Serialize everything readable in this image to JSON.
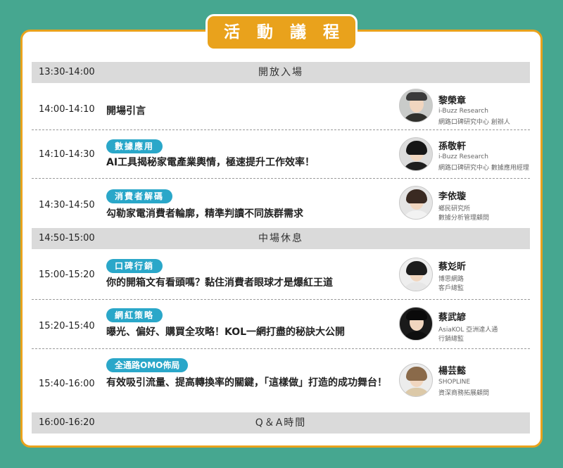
{
  "title": "活 動 議 程",
  "breaks": [
    {
      "time": "13:30-14:00",
      "label": "開放入場"
    },
    {
      "time": "14:50-15:00",
      "label": "中場休息"
    },
    {
      "time": "16:00-16:20",
      "label": "Q＆A時間"
    }
  ],
  "sessions": [
    {
      "time": "14:00-14:10",
      "tag": "",
      "topic": "開場引言",
      "speaker": {
        "name": "黎榮章",
        "org": "i-Buzz Research",
        "role": "網路口碑研究中心  創辦人"
      }
    },
    {
      "time": "14:10-14:30",
      "tag": "數據應用",
      "topic": "AI工具揭秘家電產業輿情，極速提升工作效率！",
      "speaker": {
        "name": "孫敬軒",
        "org": "i-Buzz Research",
        "role": "網路口碑研究中心 數據應用經理"
      }
    },
    {
      "time": "14:30-14:50",
      "tag": "消費者解碼",
      "topic": "勾勒家電消費者輪廓，精準判讀不同族群需求",
      "speaker": {
        "name": "李依璇",
        "org": "鄉民研究所",
        "role": "數據分析管理顧問"
      }
    },
    {
      "time": "15:00-15:20",
      "tag": "口碑行銷",
      "topic": "你的開箱文有看頭嗎？黏住消費者眼球才是爆紅王道",
      "speaker": {
        "name": "蔡彣昕",
        "org": "博思網路",
        "role": "客戶總監"
      }
    },
    {
      "time": "15:20-15:40",
      "tag": "網紅策略",
      "topic": "曝光、偏好、購買全攻略！KOL一網打盡的秘訣大公開",
      "speaker": {
        "name": "蔡武諺",
        "org": "AsiaKOL 亞洲達人通",
        "role": "行銷總監"
      }
    },
    {
      "time": "15:40-16:00",
      "tag": "全通路OMO佈局",
      "topic": "有效吸引流量、提高轉換率的關鍵，「這樣做」打造的成功舞台！",
      "speaker": {
        "name": "楊芸懿",
        "org": "SHOPLINE",
        "role": "資深商務拓展顧問"
      }
    }
  ],
  "colors": {
    "background": "#46a790",
    "accent": "#e9a21c",
    "tag": "#2aa7c9",
    "gray_row": "#dadada"
  }
}
